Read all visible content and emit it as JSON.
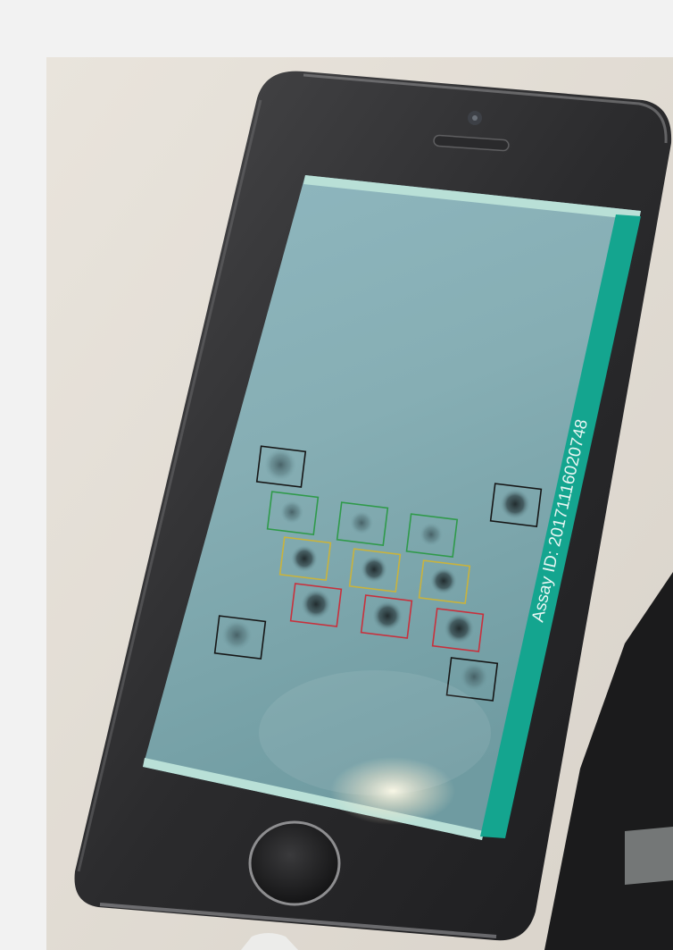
{
  "screen": {
    "assay_label": "Assay ID: 20171116020748"
  },
  "colors": {
    "accent": "#14a58f",
    "frame_green": "#2f9a4a",
    "frame_yellow": "#c9b33c",
    "frame_red": "#c8303c",
    "frame_black": "#161616"
  },
  "spots": [
    {
      "label_row": "control",
      "color": "black"
    },
    {
      "label_row": "control",
      "color": "black"
    },
    {
      "label_row": "control",
      "color": "black"
    },
    {
      "label_row": "control",
      "color": "black"
    },
    {
      "label_row": "1",
      "color": "green"
    },
    {
      "label_row": "1",
      "color": "green"
    },
    {
      "label_row": "1",
      "color": "green"
    },
    {
      "label_row": "2",
      "color": "yellow"
    },
    {
      "label_row": "2",
      "color": "yellow"
    },
    {
      "label_row": "2",
      "color": "yellow"
    },
    {
      "label_row": "3",
      "color": "red"
    },
    {
      "label_row": "3",
      "color": "red"
    },
    {
      "label_row": "3",
      "color": "red"
    }
  ]
}
